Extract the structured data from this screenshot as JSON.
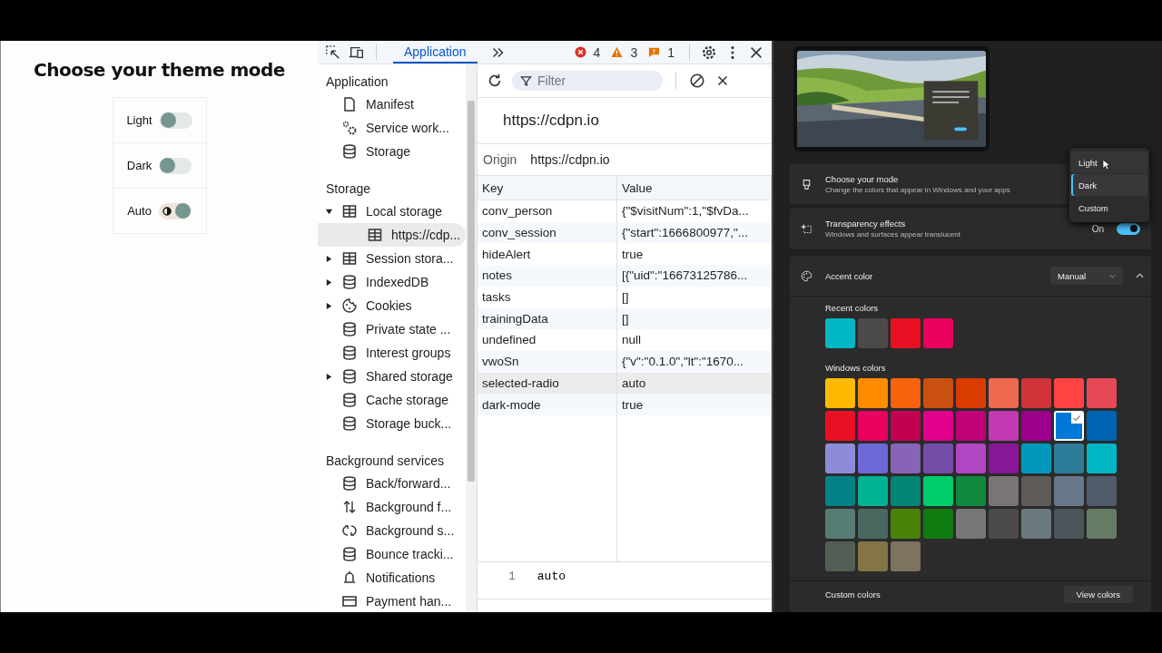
{
  "demo": {
    "title": "Choose your theme mode",
    "toggles": [
      {
        "label": "Light",
        "on": false
      },
      {
        "label": "Dark",
        "on": false
      },
      {
        "label": "Auto",
        "on": true
      }
    ]
  },
  "devtools": {
    "tabs": [
      {
        "label": "Application",
        "selected": true
      }
    ],
    "errors": "4",
    "warnings": "3",
    "issues": "1",
    "sidebar": [
      {
        "heading": "Application",
        "items": [
          {
            "label": "Manifest",
            "kind": "file",
            "selected": false
          },
          {
            "label": "Service work...",
            "kind": "gears",
            "selected": false
          },
          {
            "label": "Storage",
            "kind": "db",
            "selected": false
          }
        ]
      },
      {
        "heading": "Storage",
        "items": [
          {
            "label": "Local storage",
            "kind": "table",
            "expanded": true,
            "selected": false,
            "children": [
              {
                "label": "https://cdp...",
                "kind": "table",
                "selected": true
              }
            ]
          },
          {
            "label": "Session stora...",
            "kind": "table",
            "expanded": false,
            "selected": false
          },
          {
            "label": "IndexedDB",
            "kind": "db",
            "expanded": false,
            "selected": false
          },
          {
            "label": "Cookies",
            "kind": "cookie",
            "expanded": false,
            "selected": false
          },
          {
            "label": "Private state ...",
            "kind": "db",
            "selected": false
          },
          {
            "label": "Interest groups",
            "kind": "db",
            "selected": false
          },
          {
            "label": "Shared storage",
            "kind": "db",
            "expanded": false,
            "selected": false
          },
          {
            "label": "Cache storage",
            "kind": "db",
            "selected": false
          },
          {
            "label": "Storage buck...",
            "kind": "db",
            "selected": false
          }
        ]
      },
      {
        "heading": "Background services",
        "items": [
          {
            "label": "Back/forward...",
            "kind": "db",
            "selected": false
          },
          {
            "label": "Background f...",
            "kind": "arrows",
            "selected": false
          },
          {
            "label": "Background s...",
            "kind": "sync",
            "selected": false
          },
          {
            "label": "Bounce tracki...",
            "kind": "db",
            "selected": false
          },
          {
            "label": "Notifications",
            "kind": "bell",
            "selected": false
          },
          {
            "label": "Payment han...",
            "kind": "card",
            "selected": false
          }
        ]
      }
    ],
    "filter": {
      "placeholder": "Filter"
    },
    "origin_title": "https://cdpn.io",
    "origin_label": "Origin",
    "origin_value": "https://cdpn.io",
    "table": {
      "columns": [
        "Key",
        "Value"
      ],
      "rows": [
        {
          "key": "conv_person",
          "value": "{\"$visitNum\":1,\"$fvDa...",
          "selected": false
        },
        {
          "key": "conv_session",
          "value": "{\"start\":1666800977,\"...",
          "selected": false
        },
        {
          "key": "hideAlert",
          "value": "true",
          "selected": false
        },
        {
          "key": "notes",
          "value": "[{\"uid\":\"16673125786...",
          "selected": false
        },
        {
          "key": "tasks",
          "value": "[]",
          "selected": false
        },
        {
          "key": "trainingData",
          "value": "[]",
          "selected": false
        },
        {
          "key": "undefined",
          "value": "null",
          "selected": false
        },
        {
          "key": "vwoSn",
          "value": "{\"v\":\"0.1.0\",\"lt\":\"1670...",
          "selected": false
        },
        {
          "key": "selected-radio",
          "value": "auto",
          "selected": true
        },
        {
          "key": "dark-mode",
          "value": "true",
          "selected": false
        }
      ]
    },
    "preview": {
      "line_number": "1",
      "text": "auto"
    }
  },
  "settings": {
    "mode": {
      "title": "Choose your mode",
      "subtitle": "Change the colors that appear in Windows and your apps",
      "menu": [
        {
          "label": "Light",
          "selected": false
        },
        {
          "label": "Dark",
          "selected": true
        },
        {
          "label": "Custom",
          "selected": false
        }
      ]
    },
    "transparency": {
      "title": "Transparency effects",
      "subtitle": "Windows and surfaces appear translucent",
      "state_label": "On",
      "on": true
    },
    "accent": {
      "title": "Accent color",
      "dropdown": "Manual",
      "expanded": true,
      "recent_label": "Recent colors",
      "recent": [
        {
          "color": "#00b7c3",
          "selected": false
        },
        {
          "color": "#4c4a48",
          "selected": false
        },
        {
          "color": "#e81123",
          "selected": false
        },
        {
          "color": "#ea005e",
          "selected": false
        }
      ],
      "windows_label": "Windows colors",
      "windows": [
        {
          "color": "#ffb900",
          "selected": false
        },
        {
          "color": "#ff8c00",
          "selected": false
        },
        {
          "color": "#f7630c",
          "selected": false
        },
        {
          "color": "#ca5010",
          "selected": false
        },
        {
          "color": "#da3b01",
          "selected": false
        },
        {
          "color": "#ef6950",
          "selected": false
        },
        {
          "color": "#d13438",
          "selected": false
        },
        {
          "color": "#ff4343",
          "selected": false
        },
        {
          "color": "#e74856",
          "selected": false
        },
        {
          "color": "#e81123",
          "selected": false
        },
        {
          "color": "#ea005e",
          "selected": false
        },
        {
          "color": "#c30052",
          "selected": false
        },
        {
          "color": "#e3008c",
          "selected": false
        },
        {
          "color": "#bf0077",
          "selected": false
        },
        {
          "color": "#c239b3",
          "selected": false
        },
        {
          "color": "#9a0089",
          "selected": false
        },
        {
          "color": "#0078d7",
          "selected": true
        },
        {
          "color": "#0063b1",
          "selected": false
        },
        {
          "color": "#8e8cd8",
          "selected": false
        },
        {
          "color": "#6b69d6",
          "selected": false
        },
        {
          "color": "#8764b8",
          "selected": false
        },
        {
          "color": "#744da9",
          "selected": false
        },
        {
          "color": "#b146c2",
          "selected": false
        },
        {
          "color": "#881798",
          "selected": false
        },
        {
          "color": "#0099bc",
          "selected": false
        },
        {
          "color": "#2d7d9a",
          "selected": false
        },
        {
          "color": "#00b7c3",
          "selected": false
        },
        {
          "color": "#038387",
          "selected": false
        },
        {
          "color": "#00b294",
          "selected": false
        },
        {
          "color": "#018574",
          "selected": false
        },
        {
          "color": "#00cc6a",
          "selected": false
        },
        {
          "color": "#10893e",
          "selected": false
        },
        {
          "color": "#7a7574",
          "selected": false
        },
        {
          "color": "#5d5a58",
          "selected": false
        },
        {
          "color": "#68768a",
          "selected": false
        },
        {
          "color": "#515c6b",
          "selected": false
        },
        {
          "color": "#567c73",
          "selected": false
        },
        {
          "color": "#486860",
          "selected": false
        },
        {
          "color": "#498205",
          "selected": false
        },
        {
          "color": "#107c10",
          "selected": false
        },
        {
          "color": "#767676",
          "selected": false
        },
        {
          "color": "#4c4a48",
          "selected": false
        },
        {
          "color": "#69797e",
          "selected": false
        },
        {
          "color": "#4a5459",
          "selected": false
        },
        {
          "color": "#647c64",
          "selected": false
        },
        {
          "color": "#525e54",
          "selected": false
        },
        {
          "color": "#847545",
          "selected": false
        },
        {
          "color": "#7e735f",
          "selected": false
        }
      ],
      "custom_label": "Custom colors",
      "custom_button": "View colors"
    }
  }
}
